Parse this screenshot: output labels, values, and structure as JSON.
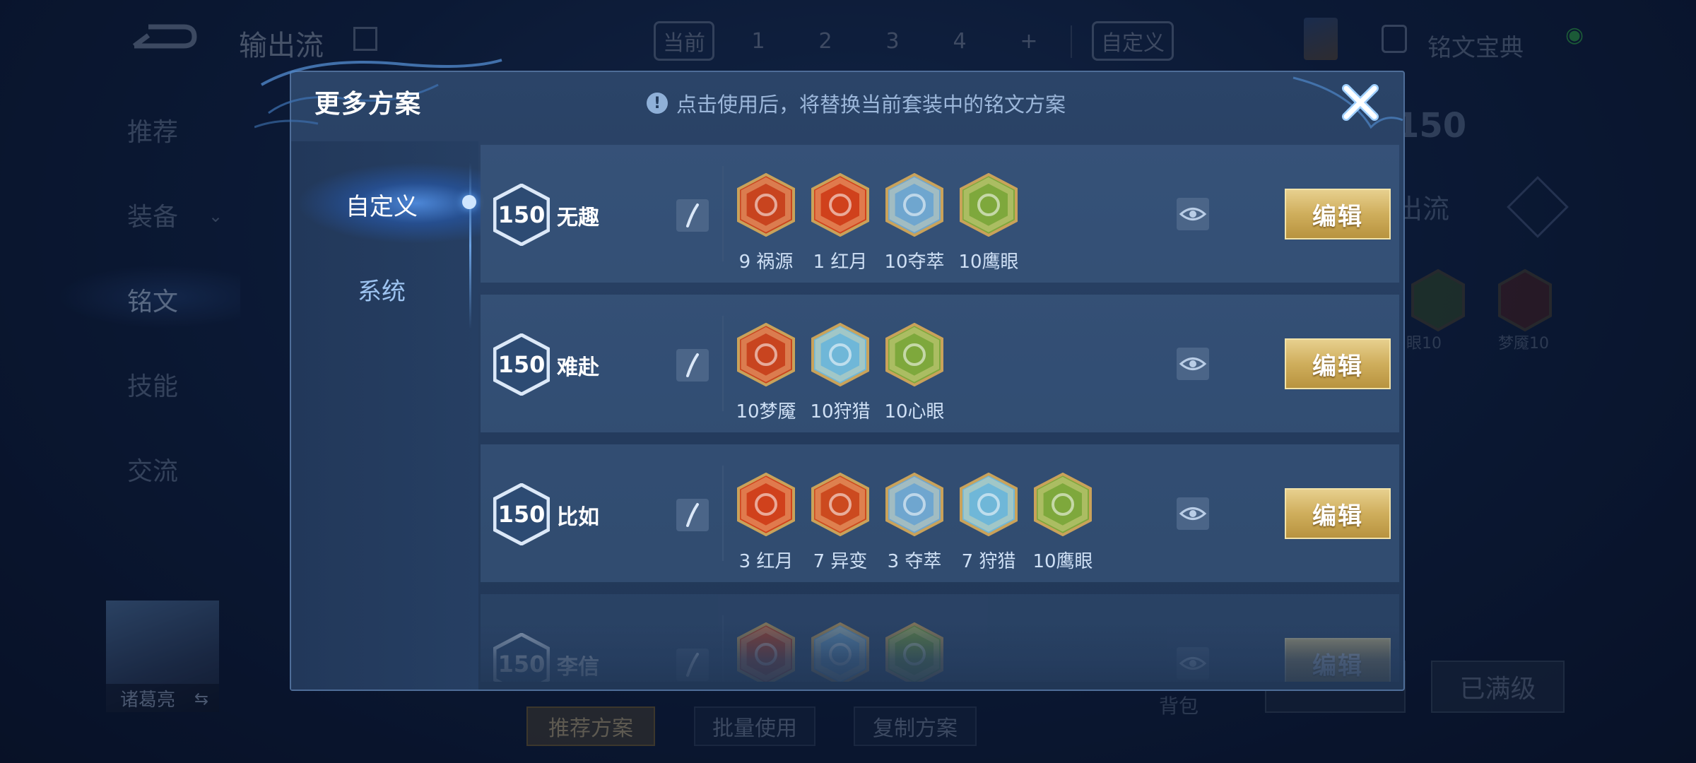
{
  "background": {
    "title": "输出流",
    "tabs": [
      "当前",
      "1",
      "2",
      "3",
      "4",
      "+"
    ],
    "custom_tab": "自定义",
    "codex": "铭文宝典",
    "nav": [
      "推荐",
      "装备",
      "铭文",
      "技能",
      "交流"
    ],
    "hero_name": "诸葛亮",
    "level": "150",
    "sub_title": "出流",
    "rune_labels": [
      "眼10",
      "梦魇10"
    ],
    "bag": "背包",
    "maxed": "已满级",
    "buttons": [
      "推荐方案",
      "批量使用",
      "复制方案"
    ]
  },
  "modal": {
    "title": "更多方案",
    "hint": "点击使用后，将替换当前套装中的铭文方案",
    "hint_icon": "!",
    "tabs": {
      "custom": "自定义",
      "system": "系统"
    },
    "edit_label": "编辑",
    "plans": [
      {
        "level": "150",
        "name": "无趣",
        "runes": [
          {
            "icon": "rune-huoyuan-icon",
            "label": "9 祸源",
            "color": "#c8441f"
          },
          {
            "icon": "rune-hongyue-icon",
            "label": "1 红月",
            "color": "#d0411c"
          },
          {
            "icon": "rune-duocui-icon",
            "label": "10夺萃",
            "color": "#6fa6cf"
          },
          {
            "icon": "rune-yingyan-icon",
            "label": "10鹰眼",
            "color": "#7ea83c"
          }
        ]
      },
      {
        "level": "150",
        "name": "难赴",
        "runes": [
          {
            "icon": "rune-mengyan-icon",
            "label": "10梦魇",
            "color": "#c8441f"
          },
          {
            "icon": "rune-shoulie-icon",
            "label": "10狩猎",
            "color": "#6fb7d8"
          },
          {
            "icon": "rune-xinyan-icon",
            "label": "10心眼",
            "color": "#7ea83c"
          }
        ]
      },
      {
        "level": "150",
        "name": "比如",
        "runes": [
          {
            "icon": "rune-hongyue-icon",
            "label": "3 红月",
            "color": "#d0411c"
          },
          {
            "icon": "rune-yibian-icon",
            "label": "7 异变",
            "color": "#cc4a1f"
          },
          {
            "icon": "rune-duocui-icon",
            "label": "3 夺萃",
            "color": "#6fa6cf"
          },
          {
            "icon": "rune-shoulie-icon",
            "label": "7 狩猎",
            "color": "#6fb7d8"
          },
          {
            "icon": "rune-yingyan-icon",
            "label": "10鹰眼",
            "color": "#7ea83c"
          }
        ]
      },
      {
        "level": "150",
        "name": "李信",
        "runes": [
          {
            "icon": "rune-red-icon",
            "label": "",
            "color": "#c8441f"
          },
          {
            "icon": "rune-blue-icon",
            "label": "",
            "color": "#6fa6cf"
          },
          {
            "icon": "rune-green-icon",
            "label": "",
            "color": "#7ea83c"
          }
        ]
      }
    ]
  }
}
